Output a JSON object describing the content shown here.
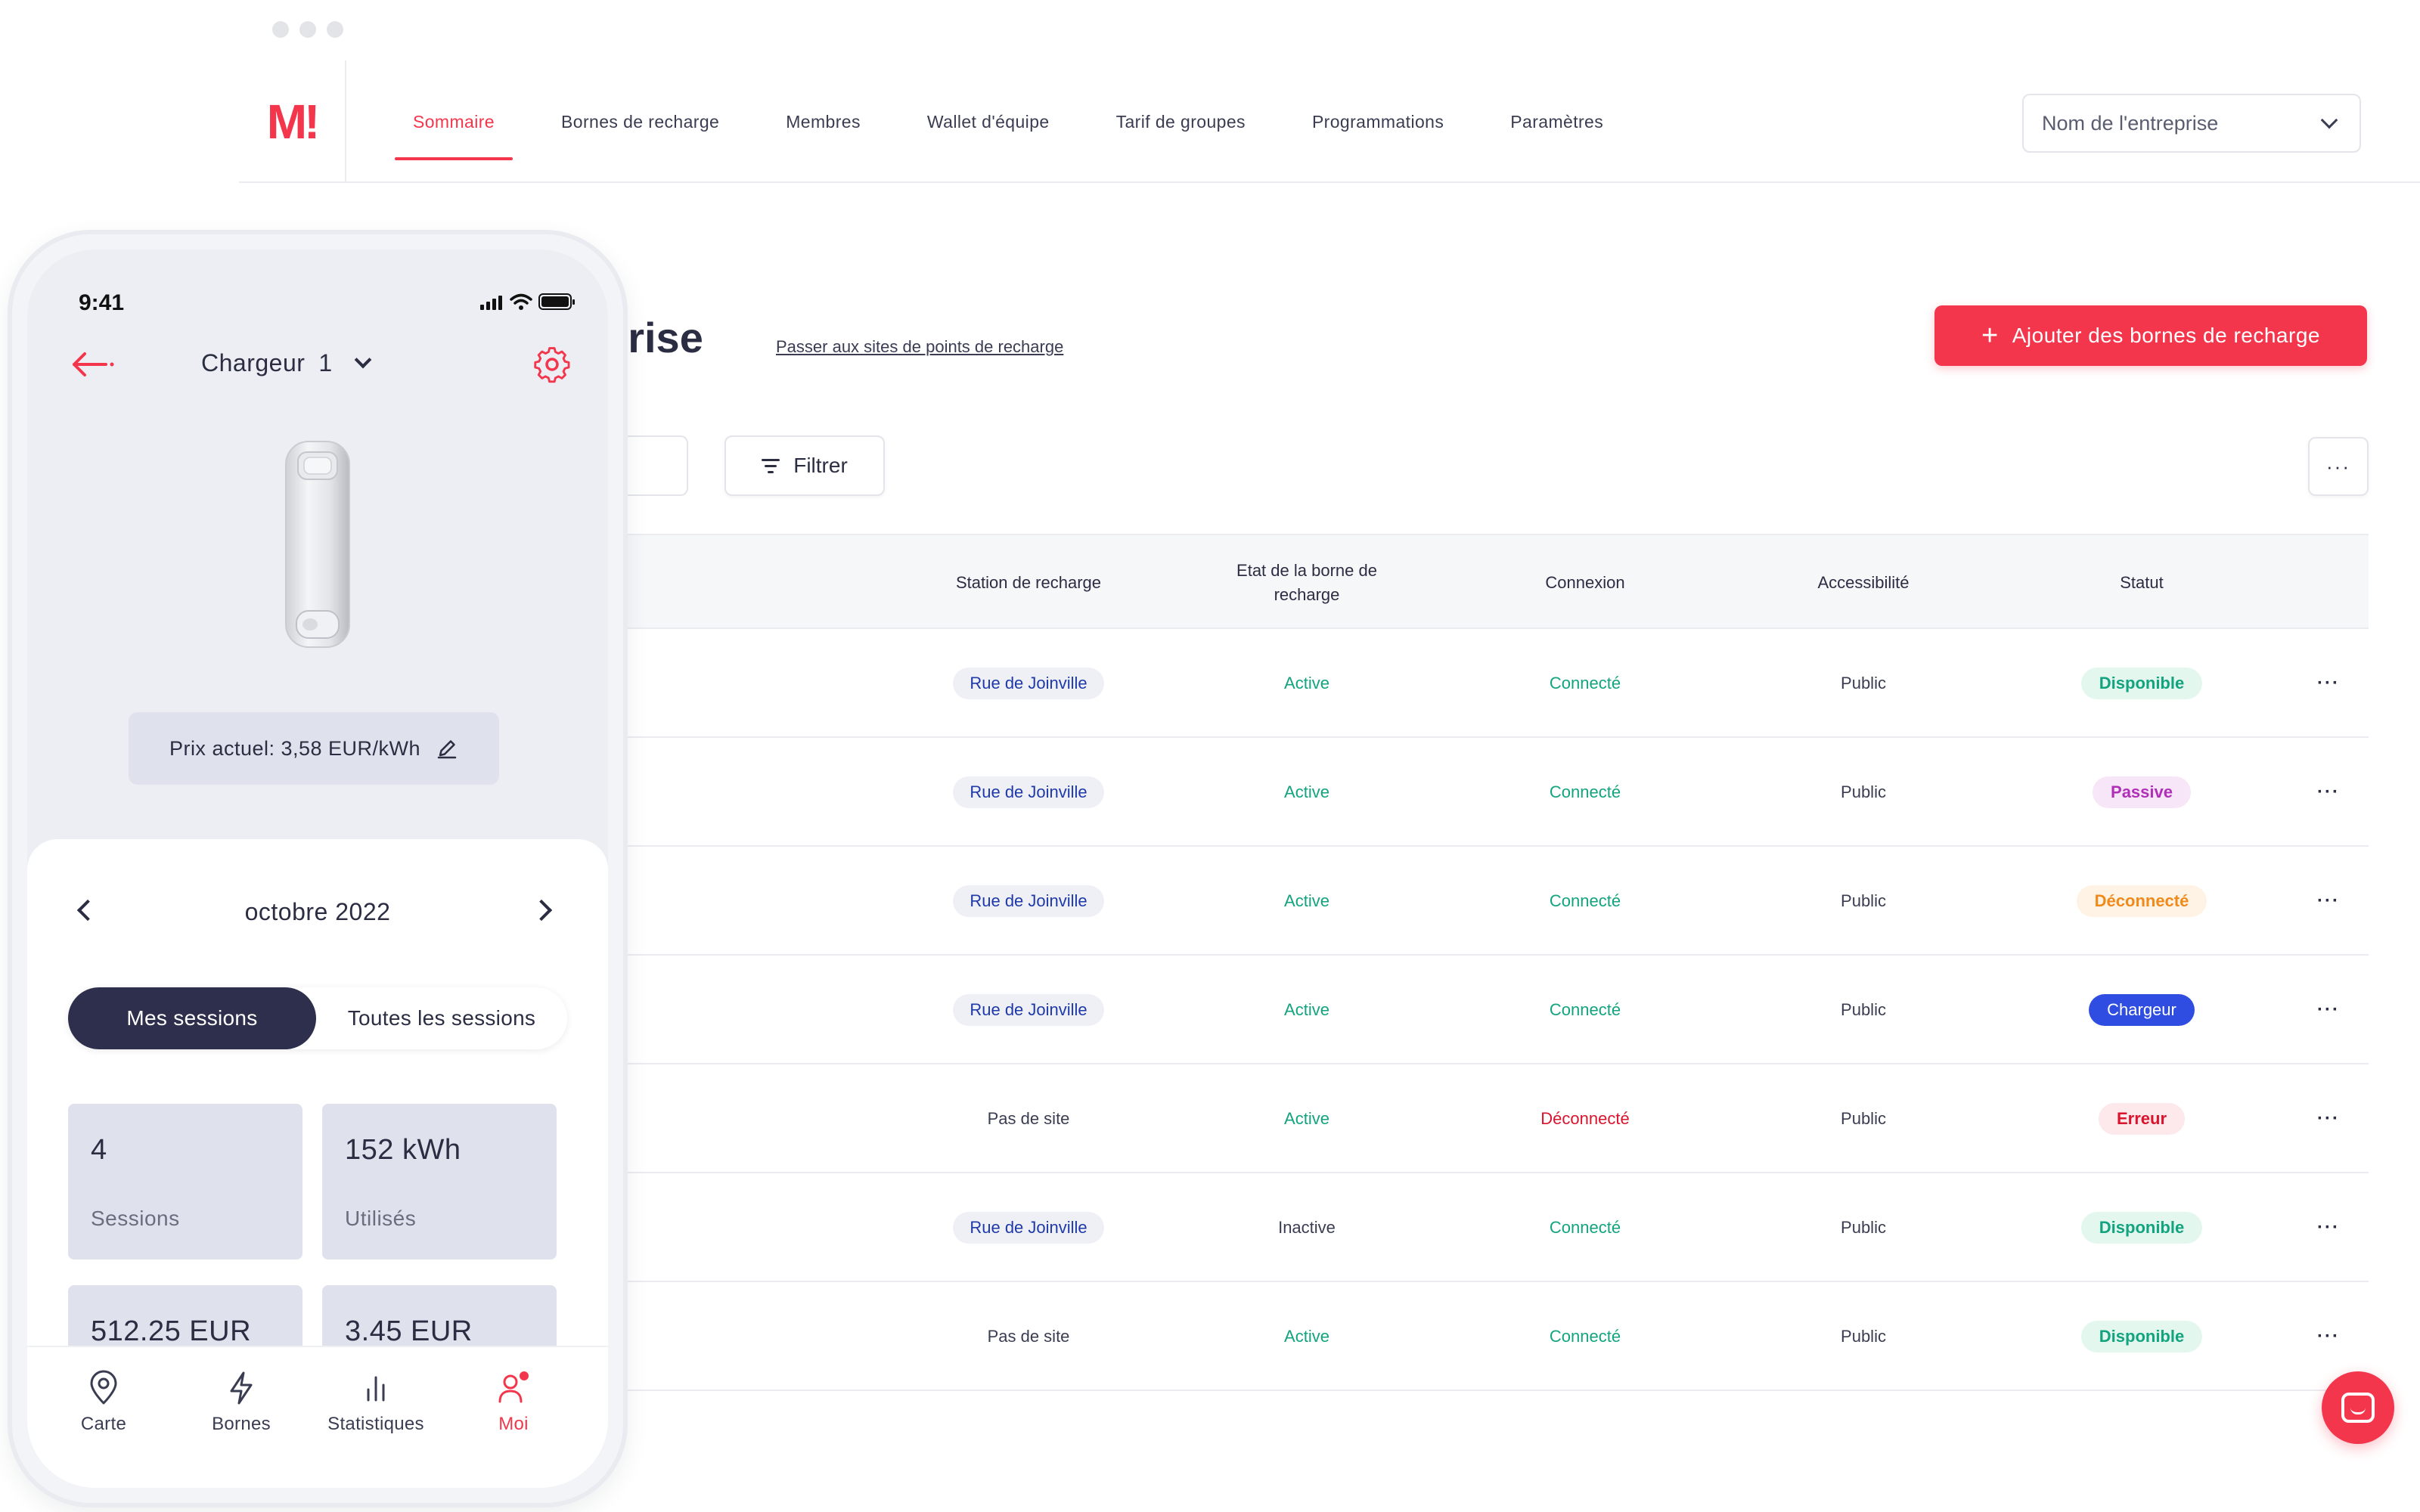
{
  "brand": {
    "logo": "M!",
    "accent": "#f4364c",
    "dark": "#2d2f4c"
  },
  "nav": {
    "items": [
      {
        "label": "Sommaire",
        "active": true
      },
      {
        "label": "Bornes de recharge",
        "active": false
      },
      {
        "label": "Membres",
        "active": false
      },
      {
        "label": "Wallet d'équipe",
        "active": false
      },
      {
        "label": "Tarif de groupes",
        "active": false
      },
      {
        "label": "Programmations",
        "active": false
      },
      {
        "label": "Paramètres",
        "active": false
      }
    ],
    "company_select": "Nom de l'entreprise"
  },
  "page": {
    "title": "prise",
    "switch_link": "Passer aux sites de points de recharge",
    "add_button": "Ajouter des bornes de recharge",
    "filter_button": "Filtrer",
    "more_button": "···"
  },
  "table": {
    "headers": [
      "Station de recharge",
      "Etat de la borne de recharge",
      "Connexion",
      "Accessibilité",
      "Statut"
    ],
    "rows": [
      {
        "station": "Rue de Joinville",
        "station_chip": true,
        "etat": "Active",
        "connexion": "Connecté",
        "accessibilite": "Public",
        "statut": "Disponible"
      },
      {
        "station": "Rue de Joinville",
        "station_chip": true,
        "etat": "Active",
        "connexion": "Connecté",
        "accessibilite": "Public",
        "statut": "Passive"
      },
      {
        "station": "Rue de Joinville",
        "station_chip": true,
        "etat": "Active",
        "connexion": "Connecté",
        "accessibilite": "Public",
        "statut": "Déconnecté"
      },
      {
        "station": "Rue de Joinville",
        "station_chip": true,
        "etat": "Active",
        "connexion": "Connecté",
        "accessibilite": "Public",
        "statut": "Chargeur"
      },
      {
        "station": "Pas de site",
        "station_chip": false,
        "etat": "Active",
        "connexion": "Déconnecté",
        "accessibilite": "Public",
        "statut": "Erreur"
      },
      {
        "station": "Rue de Joinville",
        "station_chip": true,
        "etat": "Inactive",
        "connexion": "Connecté",
        "accessibilite": "Public",
        "statut": "Disponible"
      },
      {
        "station": "Pas de site",
        "station_chip": false,
        "etat": "Active",
        "connexion": "Connecté",
        "accessibilite": "Public",
        "statut": "Disponible"
      }
    ],
    "status_styles": {
      "Disponible": {
        "bg": "#e3f7ef",
        "fg": "#13a37f"
      },
      "Passive": {
        "bg": "#f6e6f7",
        "fg": "#b02fb8"
      },
      "Déconnecté": {
        "bg": "#fff3e6",
        "fg": "#f08a1a"
      },
      "Chargeur": {
        "bg": "#2f4de0",
        "fg": "#ffffff"
      },
      "Erreur": {
        "bg": "#fde9ec",
        "fg": "#d9142d"
      }
    },
    "row_more": "···"
  },
  "phone": {
    "time": "9:41",
    "charger_name": "Chargeur",
    "charger_number": "1",
    "price": "Prix actuel: 3,58 EUR/kWh",
    "month": "octobre 2022",
    "segments": [
      "Mes sessions",
      "Toutes les sessions"
    ],
    "stats": [
      {
        "value": "4",
        "label": "Sessions"
      },
      {
        "value": "152 kWh",
        "label": "Utilisés"
      },
      {
        "value": "512.25 EUR",
        "label": ""
      },
      {
        "value": "3.45 EUR",
        "label": ""
      }
    ],
    "tabs": [
      {
        "label": "Carte",
        "icon": "map-pin-icon"
      },
      {
        "label": "Bornes",
        "icon": "lightning-icon"
      },
      {
        "label": "Statistiques",
        "icon": "bar-chart-icon"
      },
      {
        "label": "Moi",
        "icon": "user-icon",
        "active": true
      }
    ]
  }
}
